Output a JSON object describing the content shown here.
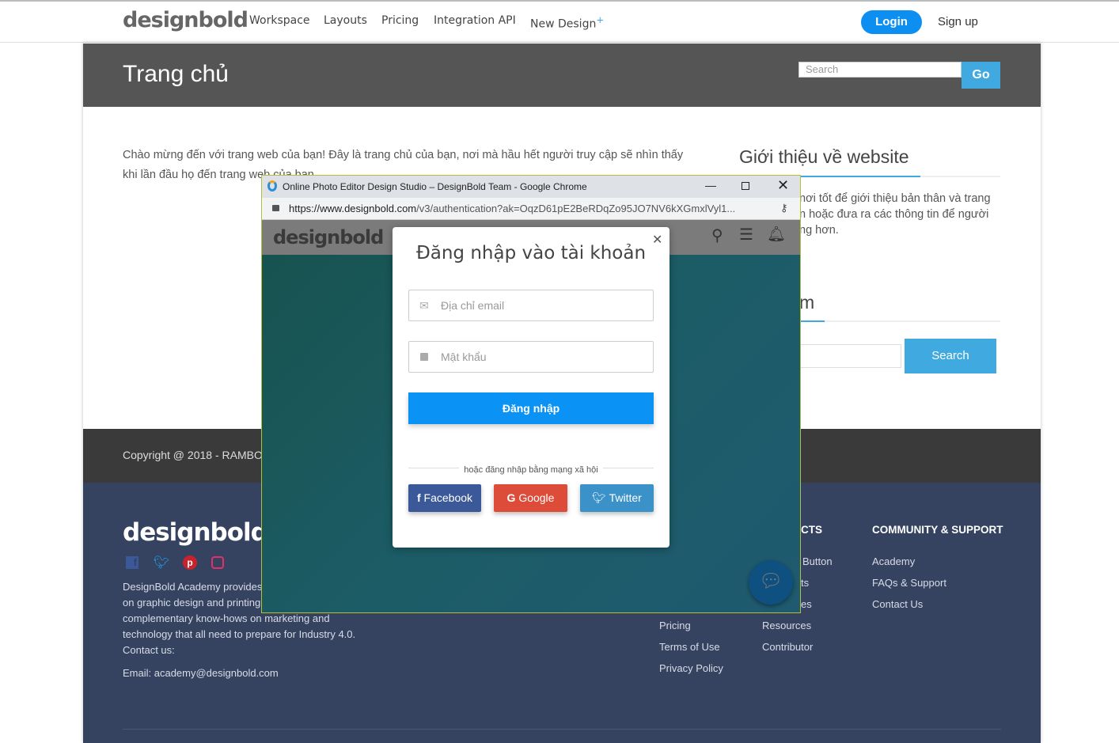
{
  "nav": {
    "logo": "designbold",
    "links": [
      "Workspace",
      "Layouts",
      "Pricing",
      "Integration API",
      "New Design"
    ],
    "new_design_plus": "+",
    "login": "Login",
    "signup": "Sign up"
  },
  "header": {
    "title": "Trang chủ",
    "search_placeholder": "Search",
    "go": "Go"
  },
  "main": {
    "intro_line1": "Chào mừng đến với trang web của bạn! Đây là trang chủ của bạn, nơi mà hầu hết người truy cập sẽ nhìn thấy",
    "intro_line2": "khi lần đầu họ đến trang web của bạn."
  },
  "sidebar": {
    "about_title": "Giới thiệu về website",
    "about_lines": [
      "nơi tốt để giới thiệu bản thân và trang",
      "n hoặc đưa ra các thông tin để người",
      "ng hơn."
    ],
    "search_title_fragment": "m",
    "search_button": "Search"
  },
  "copyright": "Copyright @ 2018 - RAMBO.",
  "footer": {
    "logo": "designbold",
    "social": [
      "facebook-icon",
      "twitter-icon",
      "pinterest-icon",
      "instagram-icon"
    ],
    "about_lines": [
      "DesignBold Academy provides",
      "on graphic design and printing,",
      "complementary know-hows on marketing and",
      "technology that all need to prepare for Industry 4.0.",
      "Contact us:"
    ],
    "email": "Email: academy@designbold.com",
    "col1": [
      "Pricing",
      "Terms of Use",
      "Privacy Policy"
    ],
    "col2_heading_fragment": "CTS",
    "col2_fragments": [
      "Button",
      "ts",
      "es"
    ],
    "col2": [
      "Resources",
      "Contributor"
    ],
    "col3_heading": "COMMUNITY & SUPPORT",
    "col3": [
      "Academy",
      "FAQs & Support",
      "Contact Us"
    ]
  },
  "popup": {
    "window_title": "Online Photo Editor Design Studio – DesignBold Team - Google Chrome",
    "url_host": "https://www.designbold.com",
    "url_path": "/v3/authentication?ak=OqzD61pE2BeRDqZo95JO7NV6kXGmxlVyl1...",
    "app_logo": "designbold",
    "modal": {
      "title": "Đăng nhập vào tài khoản",
      "email_placeholder": "Địa chỉ email",
      "password_placeholder": "Mật khẩu",
      "submit": "Đăng nhập",
      "social_divider": "hoặc đăng nhập bằng mạng xã hội",
      "facebook": "Facebook",
      "google": "Google",
      "twitter": "Twitter"
    }
  },
  "colors": {
    "accent": "#0d8ff2",
    "header_bg": "#555555",
    "footer_bg": "#354360",
    "facebook": "#3b5998",
    "google": "#dd4b39",
    "twitter": "#3a92c8"
  }
}
